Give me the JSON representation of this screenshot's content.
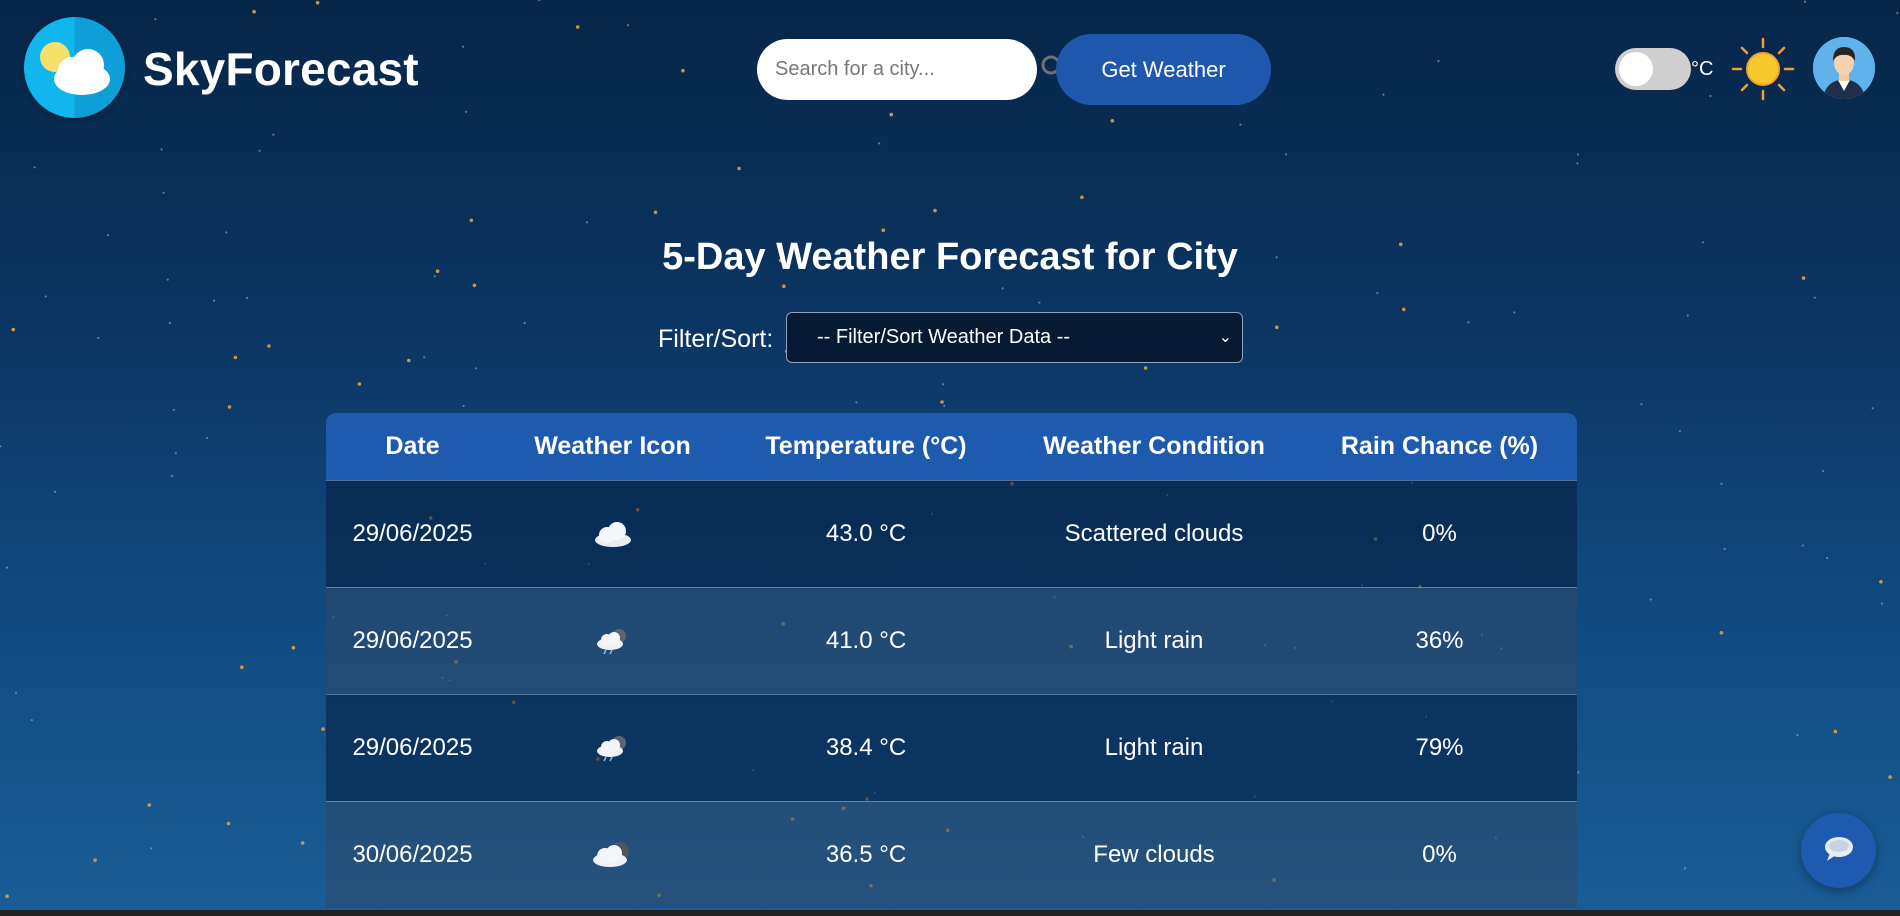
{
  "header": {
    "brand": "SkyForecast",
    "search": {
      "placeholder": "Search for a city...",
      "value": ""
    },
    "get_weather_label": "Get Weather",
    "unit_label": "°C",
    "unit_toggle_on": false
  },
  "main": {
    "title": "5-Day Weather Forecast for City",
    "filter_label": "Filter/Sort:",
    "filter_selected": "-- Filter/Sort Weather Data --"
  },
  "table": {
    "headers": [
      "Date",
      "Weather Icon",
      "Temperature (°C)",
      "Weather Condition",
      "Rain Chance (%)"
    ],
    "rows": [
      {
        "date": "29/06/2025",
        "icon": "cloud-icon",
        "temperature": "43.0 °C",
        "condition": "Scattered clouds",
        "rain": "0%"
      },
      {
        "date": "29/06/2025",
        "icon": "rain-cloud-icon",
        "temperature": "41.0 °C",
        "condition": "Light rain",
        "rain": "36%"
      },
      {
        "date": "29/06/2025",
        "icon": "rain-cloud-icon",
        "temperature": "38.4 °C",
        "condition": "Light rain",
        "rain": "79%"
      },
      {
        "date": "30/06/2025",
        "icon": "few-clouds-icon",
        "temperature": "36.5 °C",
        "condition": "Few clouds",
        "rain": "0%"
      }
    ]
  },
  "colors": {
    "accent": "#1e57ab",
    "background_top": "#062648",
    "background_bottom": "#1a5d97",
    "star": "#e0a040"
  }
}
